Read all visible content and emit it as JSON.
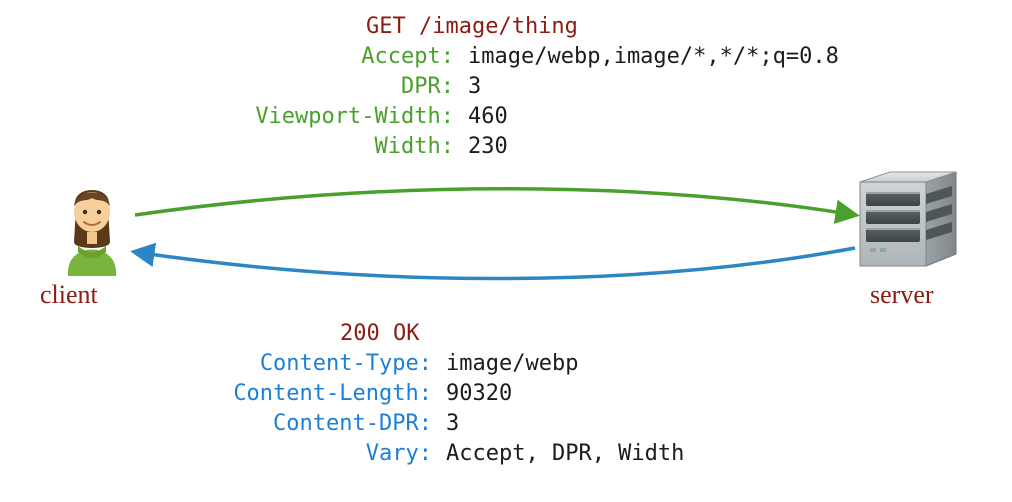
{
  "client_label": "client",
  "server_label": "server",
  "request": {
    "line": "GET /image/thing",
    "headers": [
      {
        "name": "Accept:",
        "value": "image/webp,image/*,*/*;q=0.8"
      },
      {
        "name": "DPR:",
        "value": "3"
      },
      {
        "name": "Viewport-Width:",
        "value": "460"
      },
      {
        "name": "Width:",
        "value": "230"
      }
    ]
  },
  "response": {
    "status": "200 OK",
    "headers": [
      {
        "name": "Content-Type:",
        "value": "image/webp"
      },
      {
        "name": "Content-Length:",
        "value": "90320"
      },
      {
        "name": "Content-DPR:",
        "value": "3"
      },
      {
        "name": "Vary:",
        "value": "Accept, DPR, Width"
      }
    ]
  },
  "colors": {
    "req_header_name": "#4aa02c",
    "res_header_name": "#1e7fd6",
    "emph": "#8c1c13",
    "body": "#222222",
    "arrow_req": "#4aa02c",
    "arrow_res": "#2d86c4"
  }
}
